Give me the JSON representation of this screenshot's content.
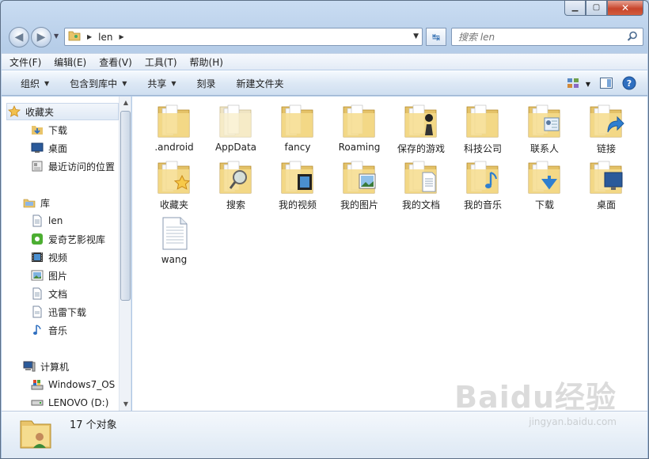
{
  "window": {
    "controls": {
      "minimize": "▁",
      "maximize": "▢",
      "close": "✕"
    }
  },
  "address": {
    "crumb": "len",
    "search_placeholder": "搜索 len"
  },
  "menu": [
    "文件(F)",
    "编辑(E)",
    "查看(V)",
    "工具(T)",
    "帮助(H)"
  ],
  "commands": [
    {
      "label": "组织",
      "dropdown": true
    },
    {
      "label": "包含到库中",
      "dropdown": true
    },
    {
      "label": "共享",
      "dropdown": true
    },
    {
      "label": "刻录",
      "dropdown": false
    },
    {
      "label": "新建文件夹",
      "dropdown": false
    }
  ],
  "nav": {
    "favorites_header": "收藏夹",
    "favorites": [
      "下载",
      "桌面",
      "最近访问的位置"
    ],
    "libraries_header": "库",
    "libraries": [
      "len",
      "爱奇艺影视库",
      "视频",
      "图片",
      "文档",
      "迅雷下载",
      "音乐"
    ],
    "computer_header": "计算机",
    "drives": [
      "Windows7_OS (",
      "LENOVO (D:)"
    ]
  },
  "items": [
    {
      "label": ".android",
      "kind": "folder-plain"
    },
    {
      "label": "AppData",
      "kind": "folder-faded"
    },
    {
      "label": "fancy",
      "kind": "folder-plain"
    },
    {
      "label": "Roaming",
      "kind": "folder-plain"
    },
    {
      "label": "保存的游戏",
      "kind": "folder-chess"
    },
    {
      "label": "科技公司",
      "kind": "folder-plain"
    },
    {
      "label": "联系人",
      "kind": "folder-contacts"
    },
    {
      "label": "链接",
      "kind": "folder-link"
    },
    {
      "label": "收藏夹",
      "kind": "folder-star"
    },
    {
      "label": "搜索",
      "kind": "folder-search"
    },
    {
      "label": "我的视频",
      "kind": "folder-video"
    },
    {
      "label": "我的图片",
      "kind": "folder-picture"
    },
    {
      "label": "我的文档",
      "kind": "folder-docs"
    },
    {
      "label": "我的音乐",
      "kind": "folder-music"
    },
    {
      "label": "下载",
      "kind": "folder-download"
    },
    {
      "label": "桌面",
      "kind": "folder-desktop"
    },
    {
      "label": "wang",
      "kind": "file"
    }
  ],
  "status": {
    "count": "17 个对象"
  },
  "watermark": {
    "logo": "Baidu经验",
    "url": "jingyan.baidu.com"
  }
}
